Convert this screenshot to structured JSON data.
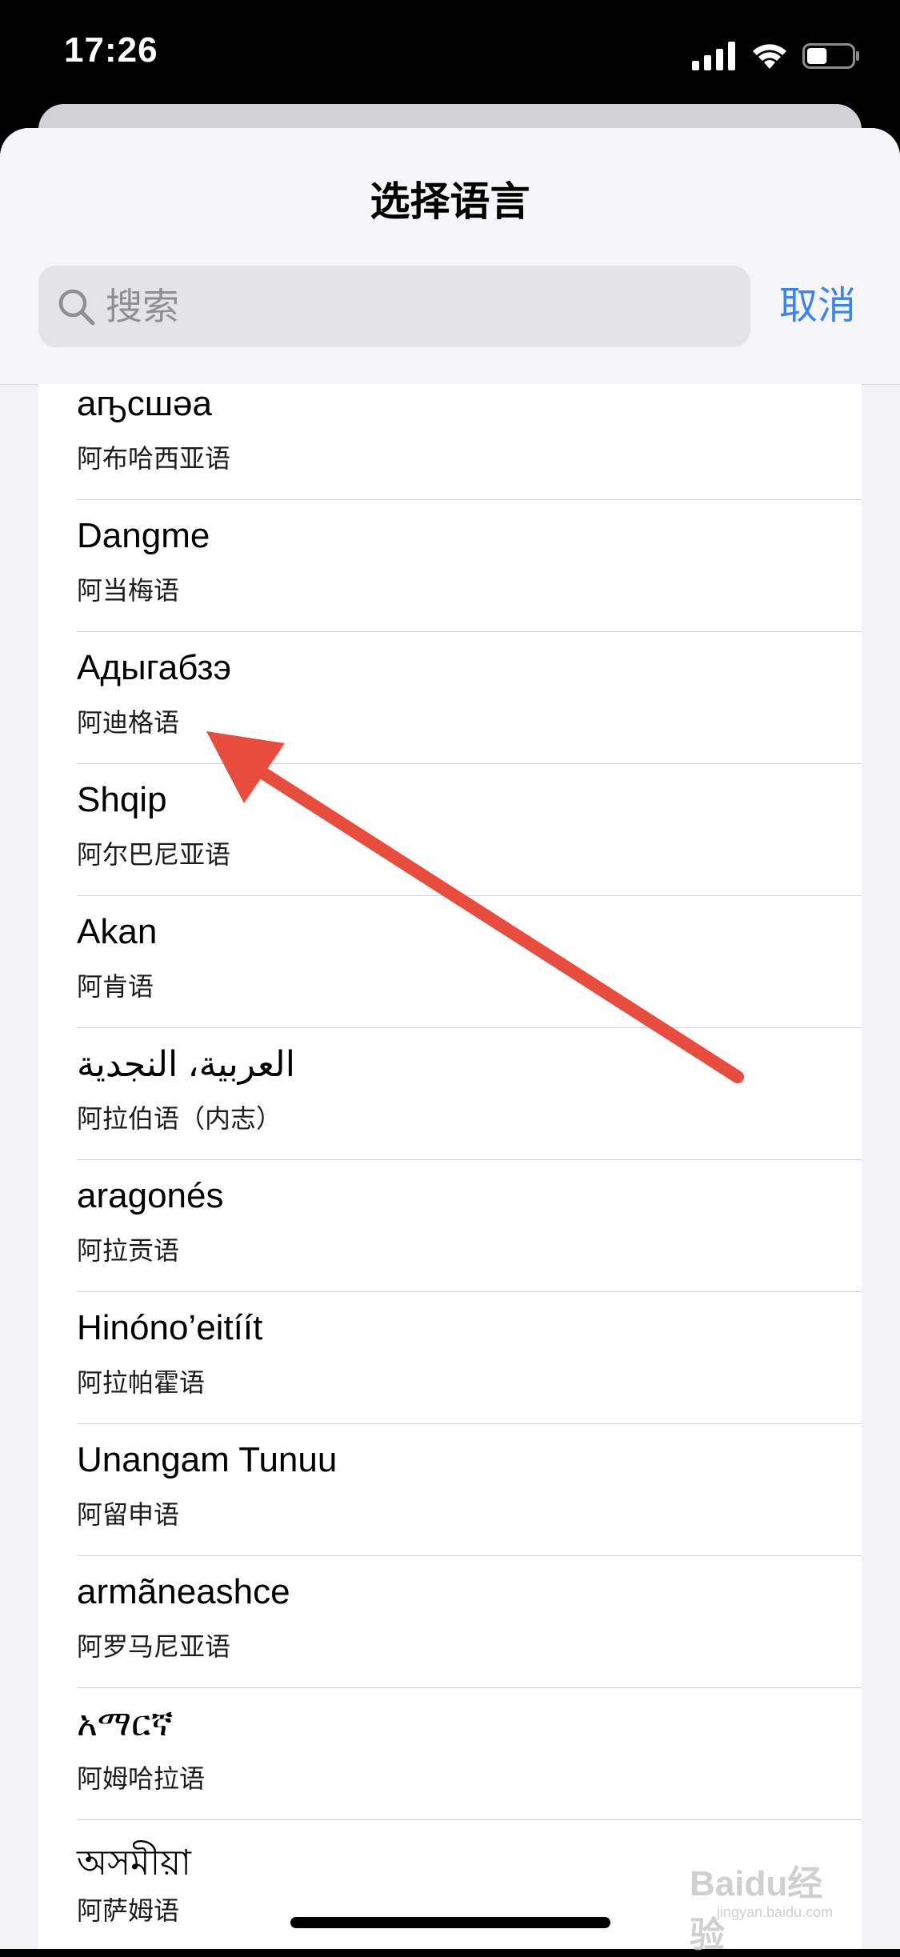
{
  "status_bar": {
    "time": "17:26",
    "battery_level": 0.45
  },
  "sheet": {
    "title": "选择语言",
    "search": {
      "placeholder": "搜索",
      "value": ""
    },
    "cancel_label": "取消"
  },
  "languages": [
    {
      "native": "aҧсшәа",
      "chinese": "阿布哈西亚语"
    },
    {
      "native": "Dangme",
      "chinese": "阿当梅语"
    },
    {
      "native": "Адыгабзэ",
      "chinese": "阿迪格语"
    },
    {
      "native": "Shqip",
      "chinese": "阿尔巴尼亚语"
    },
    {
      "native": "Akan",
      "chinese": "阿肯语"
    },
    {
      "native": "العربية، النجدية",
      "chinese": "阿拉伯语（内志）"
    },
    {
      "native": "aragonés",
      "chinese": "阿拉贡语"
    },
    {
      "native": "Hinóno’eitíít",
      "chinese": "阿拉帕霍语"
    },
    {
      "native": "Unangam Tunuu",
      "chinese": "阿留申语"
    },
    {
      "native": "armãneashce",
      "chinese": "阿罗马尼亚语"
    },
    {
      "native": "አማርኛ",
      "chinese": "阿姆哈拉语"
    },
    {
      "native": "অসমীয়া",
      "chinese": "阿萨姆语"
    }
  ],
  "annotation": {
    "arrow_color": "#e84c3d"
  },
  "watermark": {
    "main": "Baidu经验",
    "sub": "jingyan.baidu.com"
  },
  "colors": {
    "accent": "#3a82f7",
    "sheet_background": "#f2f2f7"
  }
}
